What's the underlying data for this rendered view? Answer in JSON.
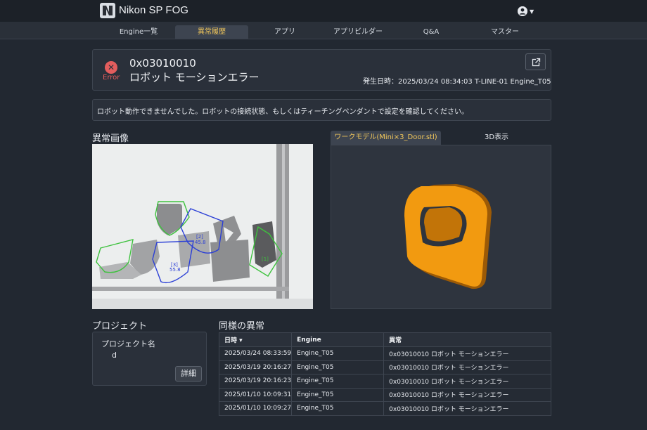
{
  "header": {
    "app_title": "Nikon SP FOG",
    "logo_icon": "nikon-logo-icon",
    "user_icon": "user-circle-icon"
  },
  "nav": {
    "tabs": [
      "Engine一覧",
      "異常履歴",
      "アプリ",
      "アプリビルダー",
      "Q&A",
      "マスター"
    ],
    "active": "異常履歴"
  },
  "error": {
    "status_label": "Error",
    "code": "0x03010010",
    "title": "ロボット モーションエラー",
    "meta": "発生日時：2025/03/24 08:34:03  T-LINE-01  Engine_T05"
  },
  "message": "ロボット動作できませんでした。ロボットの接続状態、もしくはティーチングペンダントで設定を確認してください。",
  "image_section": {
    "title": "異常画像",
    "detections": [
      {
        "id": "[1]",
        "score": ""
      },
      {
        "id": "[2]",
        "score": "45.8"
      },
      {
        "id": "[3]",
        "score": "55.8"
      }
    ]
  },
  "model_section": {
    "tabs": [
      "ワークモデル(Mini×3_Door.stl)",
      "3D表示"
    ],
    "active": 0
  },
  "project": {
    "title": "プロジェクト",
    "label": "プロジェクト名",
    "value": "d",
    "detail_button": "詳細"
  },
  "similar": {
    "title": "同様の異常",
    "columns": [
      "日時 ▾",
      "Engine",
      "異常"
    ],
    "rows": [
      [
        "2025/03/24 08:33:59",
        "Engine_T05",
        "0x03010010 ロボット モーションエラー"
      ],
      [
        "2025/03/19 20:16:27",
        "Engine_T05",
        "0x03010010 ロボット モーションエラー"
      ],
      [
        "2025/03/19 20:16:23",
        "Engine_T05",
        "0x03010010 ロボット モーションエラー"
      ],
      [
        "2025/01/10 10:09:31",
        "Engine_T05",
        "0x03010010 ロボット モーションエラー"
      ],
      [
        "2025/01/10 10:09:27",
        "Engine_T05",
        "0x03010010 ロボット モーションエラー"
      ]
    ]
  },
  "colors": {
    "accent": "#f1c75b",
    "error": "#e35d5d",
    "detect_green": "#3ec23e",
    "detect_blue": "#2b3fd6",
    "part_orange": "#f29a10"
  }
}
